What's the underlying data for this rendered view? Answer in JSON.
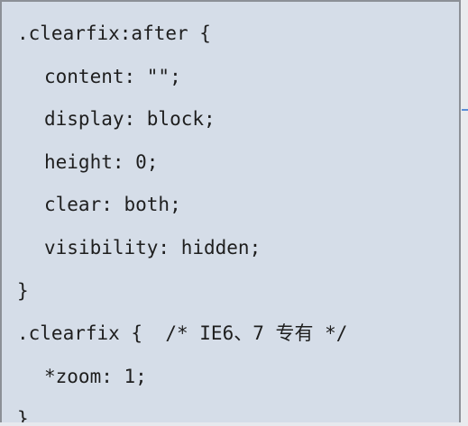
{
  "code": {
    "lines": [
      ".clearfix:after {",
      "content: \"\";",
      "display: block;",
      "height: 0;",
      "clear: both;",
      "visibility: hidden;",
      "}",
      ".clearfix {  /* IE6、7 专有 */",
      "*zoom: 1;",
      "}"
    ]
  },
  "colors": {
    "background": "#d5dde8",
    "border": "#8c9097",
    "text": "#1e1e1e",
    "accent_mark": "#5b8fd6"
  }
}
